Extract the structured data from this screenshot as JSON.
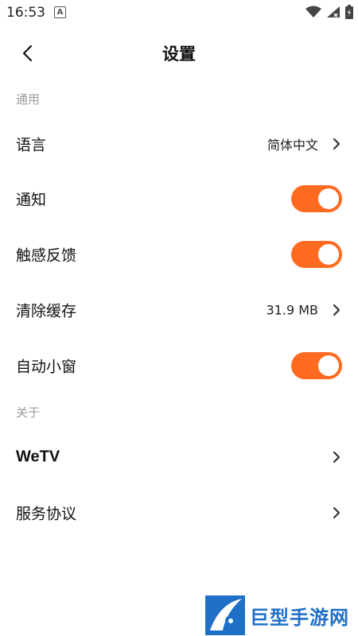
{
  "status_bar": {
    "time": "16:53",
    "notif_letter": "A"
  },
  "header": {
    "title": "设置"
  },
  "sections": {
    "general": "通用",
    "about": "关于"
  },
  "rows": {
    "language": {
      "label": "语言",
      "value": "简体中文"
    },
    "notifications": {
      "label": "通知",
      "on": true
    },
    "haptic": {
      "label": "触感反馈",
      "on": true
    },
    "clear_cache": {
      "label": "清除缓存",
      "value": "31.9 MB"
    },
    "pip": {
      "label": "自动小窗",
      "on": true
    },
    "wetv": {
      "label": "WeTV"
    },
    "terms": {
      "label": "服务协议"
    }
  },
  "watermark": {
    "text": "巨型手游网"
  },
  "colors": {
    "accent": "#ff6a21",
    "section_label": "#9a9a9a",
    "brand_blue": "#1f6fc7"
  }
}
